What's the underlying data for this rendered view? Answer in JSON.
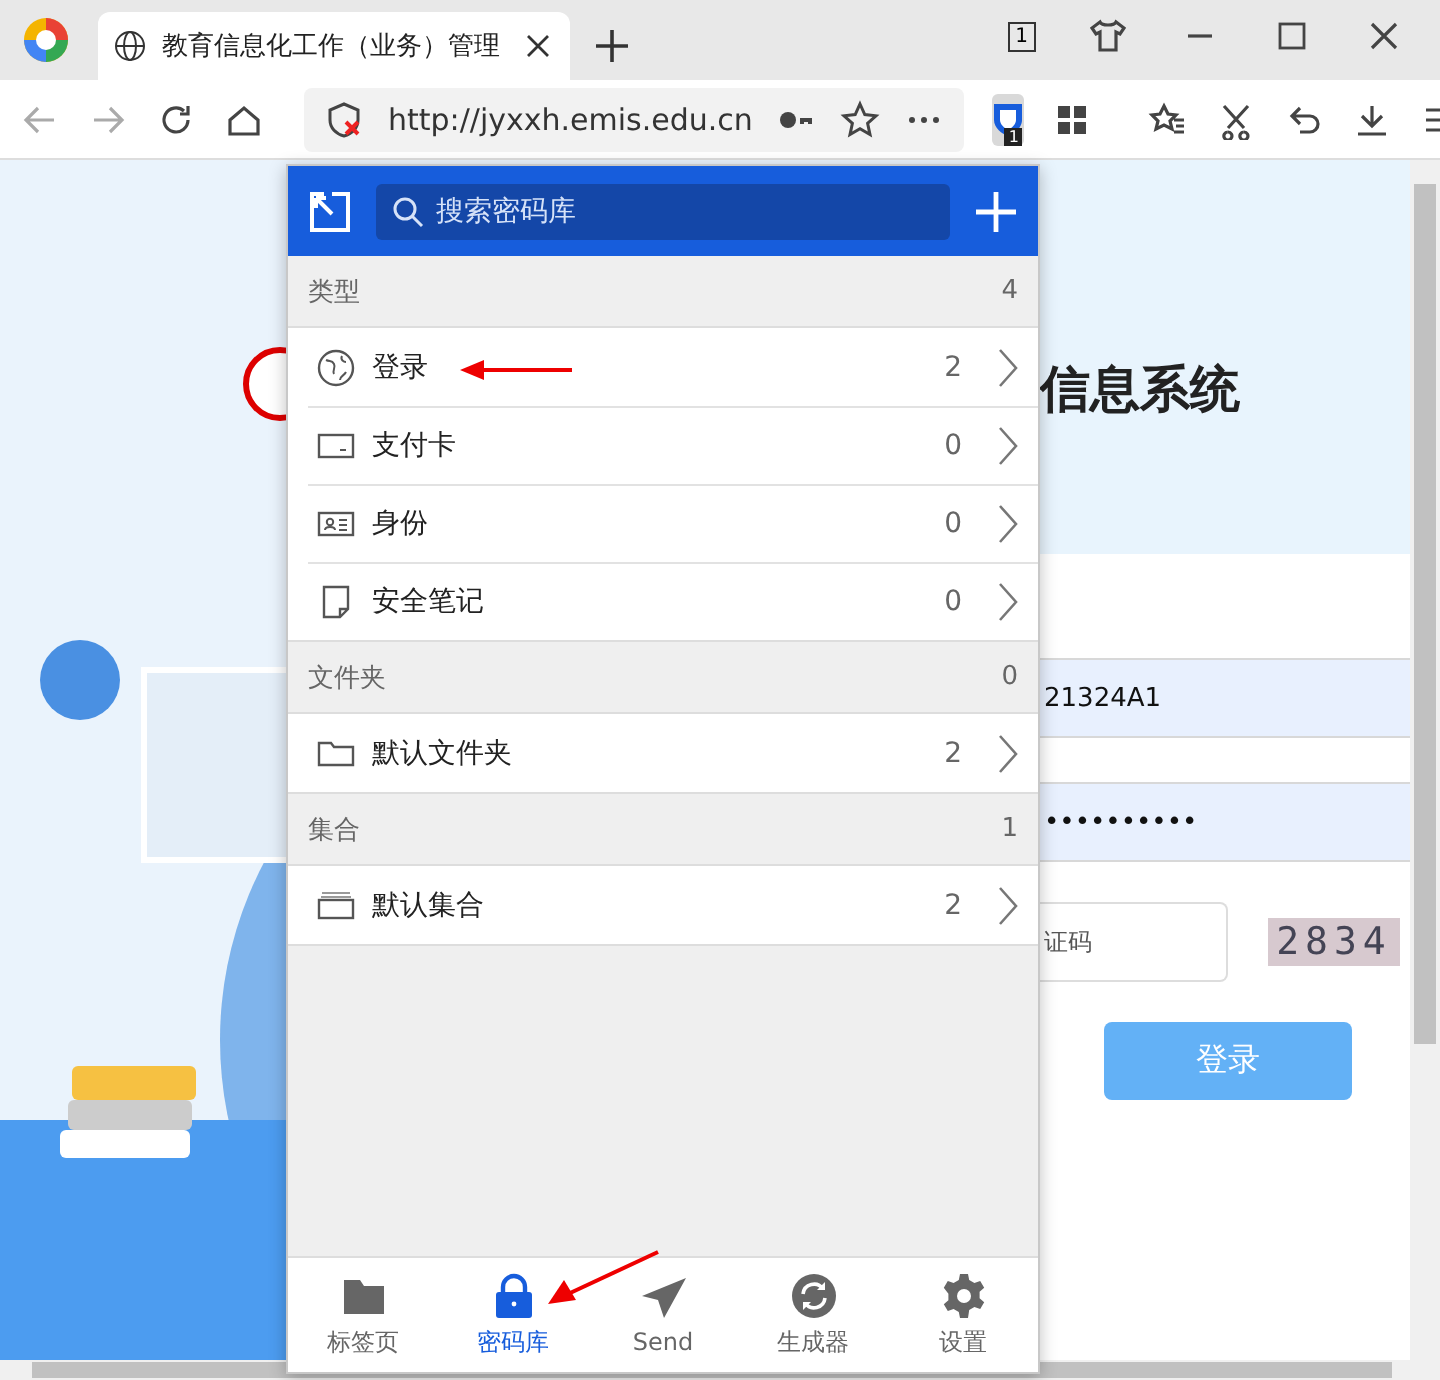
{
  "browser": {
    "tab_title": "教育信息化工作（业务）管理",
    "tab_count": "1",
    "url": "http://jyxxh.emis.edu.cn",
    "extension_badge": "1"
  },
  "page": {
    "title": "信息系统",
    "username_value": "21324A1",
    "password_value": "••••••••••",
    "captcha_placeholder": "证码",
    "captcha_image_text": "2834",
    "login_button": "登录"
  },
  "popup": {
    "search_placeholder": "搜索密码库",
    "sections": [
      {
        "title": "类型",
        "count": "4",
        "items": [
          {
            "kind": "login",
            "label": "登录",
            "count": "2"
          },
          {
            "kind": "card",
            "label": "支付卡",
            "count": "0"
          },
          {
            "kind": "identity",
            "label": "身份",
            "count": "0"
          },
          {
            "kind": "note",
            "label": "安全笔记",
            "count": "0"
          }
        ]
      },
      {
        "title": "文件夹",
        "count": "0",
        "items": [
          {
            "kind": "folder",
            "label": "默认文件夹",
            "count": "2"
          }
        ]
      },
      {
        "title": "集合",
        "count": "1",
        "items": [
          {
            "kind": "collection",
            "label": "默认集合",
            "count": "2"
          }
        ]
      }
    ],
    "nav": [
      {
        "kind": "tabs",
        "label": "标签页",
        "selected": false
      },
      {
        "kind": "vault",
        "label": "密码库",
        "selected": true
      },
      {
        "kind": "send",
        "label": "Send",
        "selected": false
      },
      {
        "kind": "generator",
        "label": "生成器",
        "selected": false
      },
      {
        "kind": "settings",
        "label": "设置",
        "selected": false
      }
    ]
  }
}
